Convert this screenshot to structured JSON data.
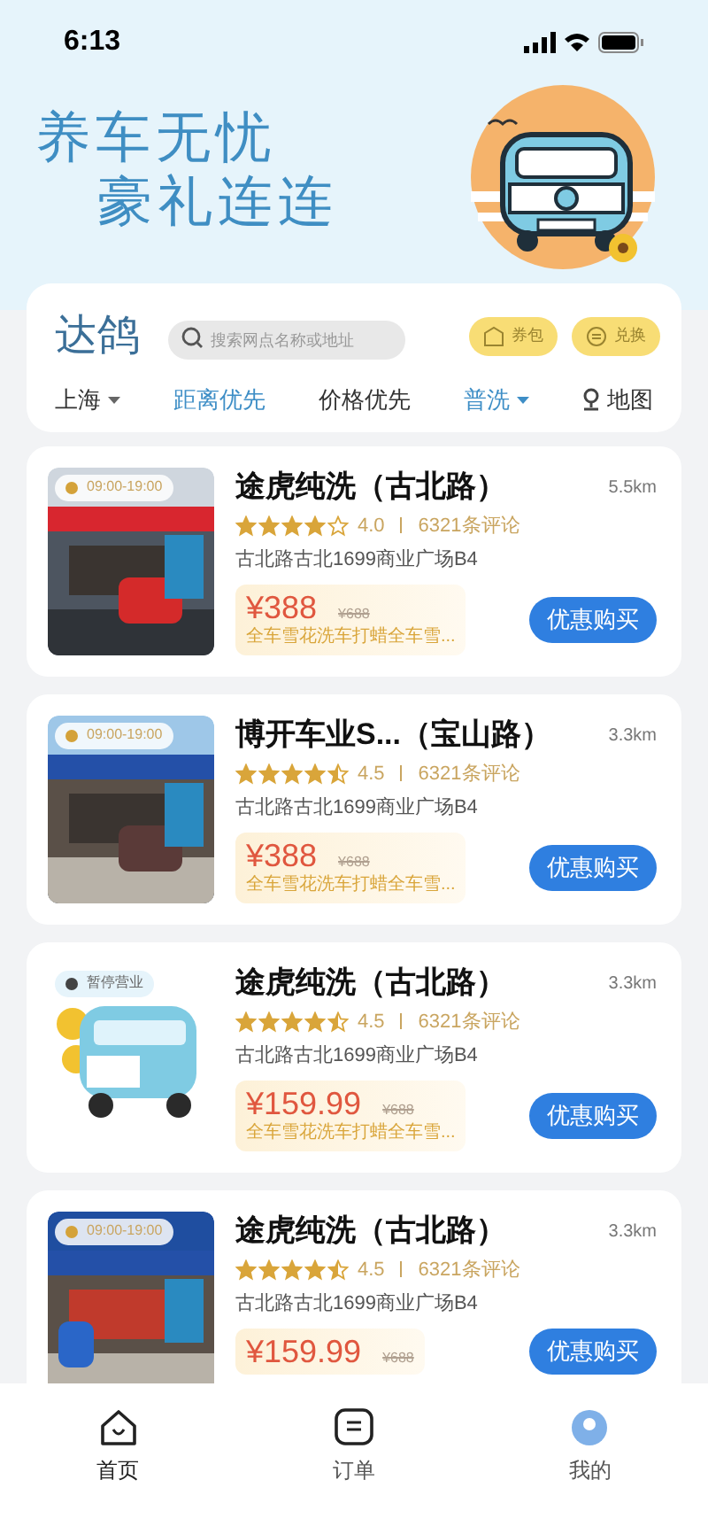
{
  "status_bar": {
    "time": "6:13"
  },
  "banner": {
    "lines": [
      "养车无忧",
      "豪礼连连"
    ]
  },
  "header": {
    "brand": "达鸽",
    "search": {
      "placeholder": "搜索网点名称或地址"
    },
    "actions": [
      "券包",
      "兑换"
    ]
  },
  "filters": [
    {
      "kind": "dropdown",
      "label": "上海",
      "selected": false
    },
    {
      "kind": "option",
      "label": "距离优先",
      "selected": true
    },
    {
      "kind": "option",
      "label": "价格优先",
      "selected": false
    },
    {
      "kind": "dropdown",
      "label": "普洗",
      "selected": true
    },
    {
      "kind": "map",
      "label": "地图",
      "selected": false
    }
  ],
  "shops": [
    {
      "hours": "09:00-19:00",
      "open": true,
      "name": "途虎纯洗（古北路）",
      "distance": "5.5km",
      "stars": 4,
      "rating": "4.0",
      "reviews": "6321条评论",
      "address": "古北路古北1699商业广场B4",
      "price": "¥388",
      "old_price": "¥688",
      "description": "全车雪花洗车打蜡全车雪...",
      "button": "优惠购买"
    },
    {
      "hours": "09:00-19:00",
      "open": true,
      "name": "博开车业S...（宝山路）",
      "distance": "3.3km",
      "stars": 4.5,
      "rating": "4.5",
      "reviews": "6321条评论",
      "address": "古北路古北1699商业广场B4",
      "price": "¥388",
      "old_price": "¥688",
      "description": "全车雪花洗车打蜡全车雪...",
      "button": "优惠购买"
    },
    {
      "hours": "暂停营业",
      "open": false,
      "name": "途虎纯洗（古北路）",
      "distance": "3.3km",
      "stars": 4.5,
      "rating": "4.5",
      "reviews": "6321条评论",
      "address": "古北路古北1699商业广场B4",
      "price": "¥159.99",
      "old_price": "¥688",
      "description": "全车雪花洗车打蜡全车雪...",
      "button": "优惠购买"
    },
    {
      "hours": "09:00-19:00",
      "open": true,
      "name": "途虎纯洗（古北路）",
      "distance": "3.3km",
      "stars": 4.5,
      "rating": "4.5",
      "reviews": "6321条评论",
      "address": "古北路古北1699商业广场B4",
      "price": "¥159.99",
      "old_price": "¥688",
      "button": "优惠购买"
    }
  ],
  "tab_bar": [
    {
      "label": "首页",
      "selected": true
    },
    {
      "label": "订单",
      "selected": false
    },
    {
      "label": "我的",
      "selected": false
    }
  ]
}
